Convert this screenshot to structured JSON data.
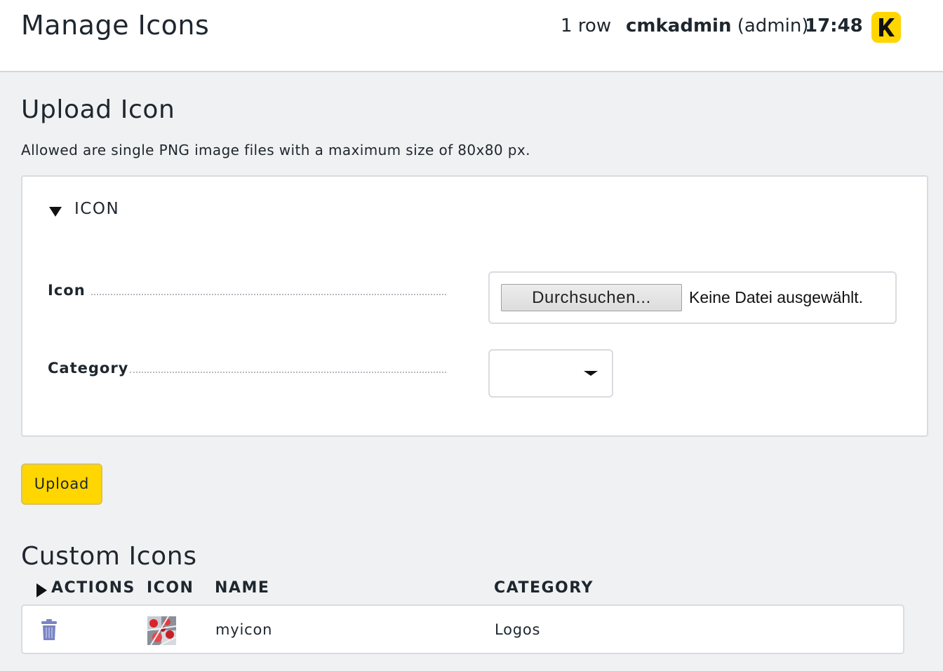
{
  "header": {
    "title": "Manage Icons",
    "row_count": "1 row",
    "user_name": "cmkadmin",
    "user_role": "(admin)",
    "time": "17:48",
    "logo_color": "#ffd600"
  },
  "upload_section": {
    "title": "Upload Icon",
    "description": "Allowed are single PNG image files with a maximum size of 80x80 px.",
    "fold_title": "ICON",
    "icon_label": "Icon",
    "browse_button": "Durchsuchen...",
    "file_status": "Keine Datei ausgewählt.",
    "category_label": "Category",
    "category_value": "",
    "upload_button": "Upload",
    "upload_button_color": "#ffd600"
  },
  "custom_icons": {
    "title": "Custom Icons",
    "columns": [
      "ACTIONS",
      "ICON",
      "NAME",
      "CATEGORY"
    ],
    "rows": [
      {
        "action_icon": "trash-icon",
        "icon": "image-thumbnail",
        "name": "myicon",
        "category": "Logos"
      }
    ]
  }
}
